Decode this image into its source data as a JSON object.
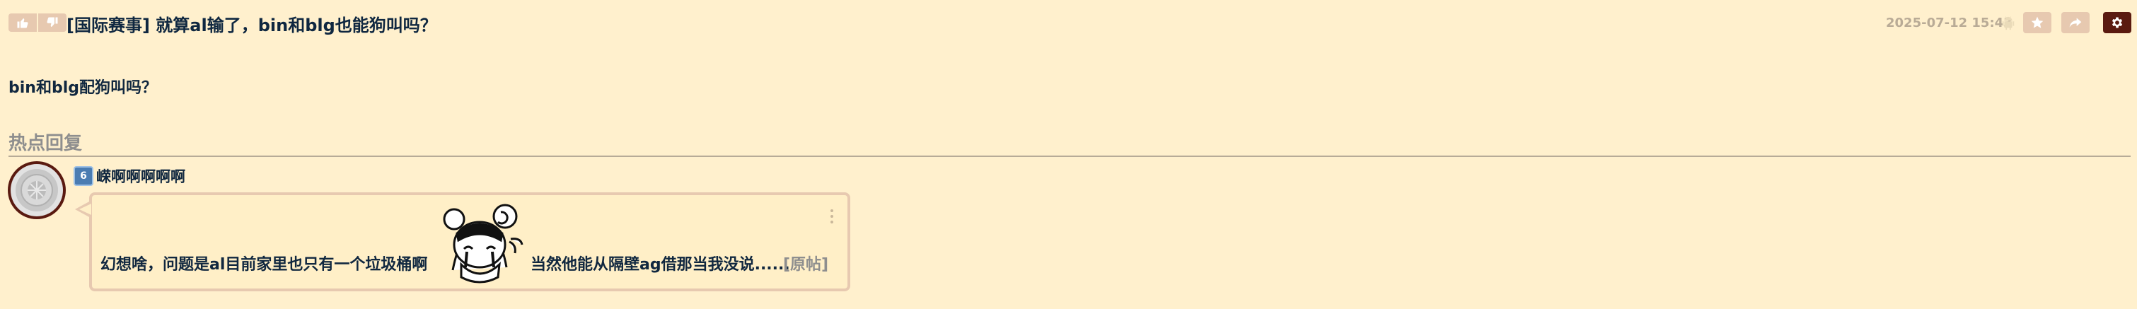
{
  "thread": {
    "title": "[国际赛事] 就算al输了，bin和blg也能狗叫吗？",
    "date": "2025-07-12 15:43",
    "body": "bin和blg配狗叫吗？"
  },
  "icons": {
    "upvote": "thumbs-up-icon",
    "downvote": "thumbs-down-icon",
    "platform": "android-icon",
    "favorite": "star-icon",
    "share": "share-icon",
    "settings": "gear-icon",
    "more": "more-vertical-icon"
  },
  "hot_replies": {
    "heading": "热点回复",
    "items": [
      {
        "badge": "6",
        "username": "嵘啊啊啊啊啊",
        "text_before": "幻想啥，问题是al目前家里也只有一个垃圾桶啊",
        "sticker": "crying-anime-girl-sticker",
        "text_after": "当然他能从隔壁ag借那当我没说......",
        "original_link": "[原帖]"
      }
    ]
  },
  "colors": {
    "background": "#fff0cd",
    "button": "#e7c9b0",
    "settings_button": "#5a1a10",
    "text": "#10273f",
    "muted": "#8e8e8e"
  }
}
